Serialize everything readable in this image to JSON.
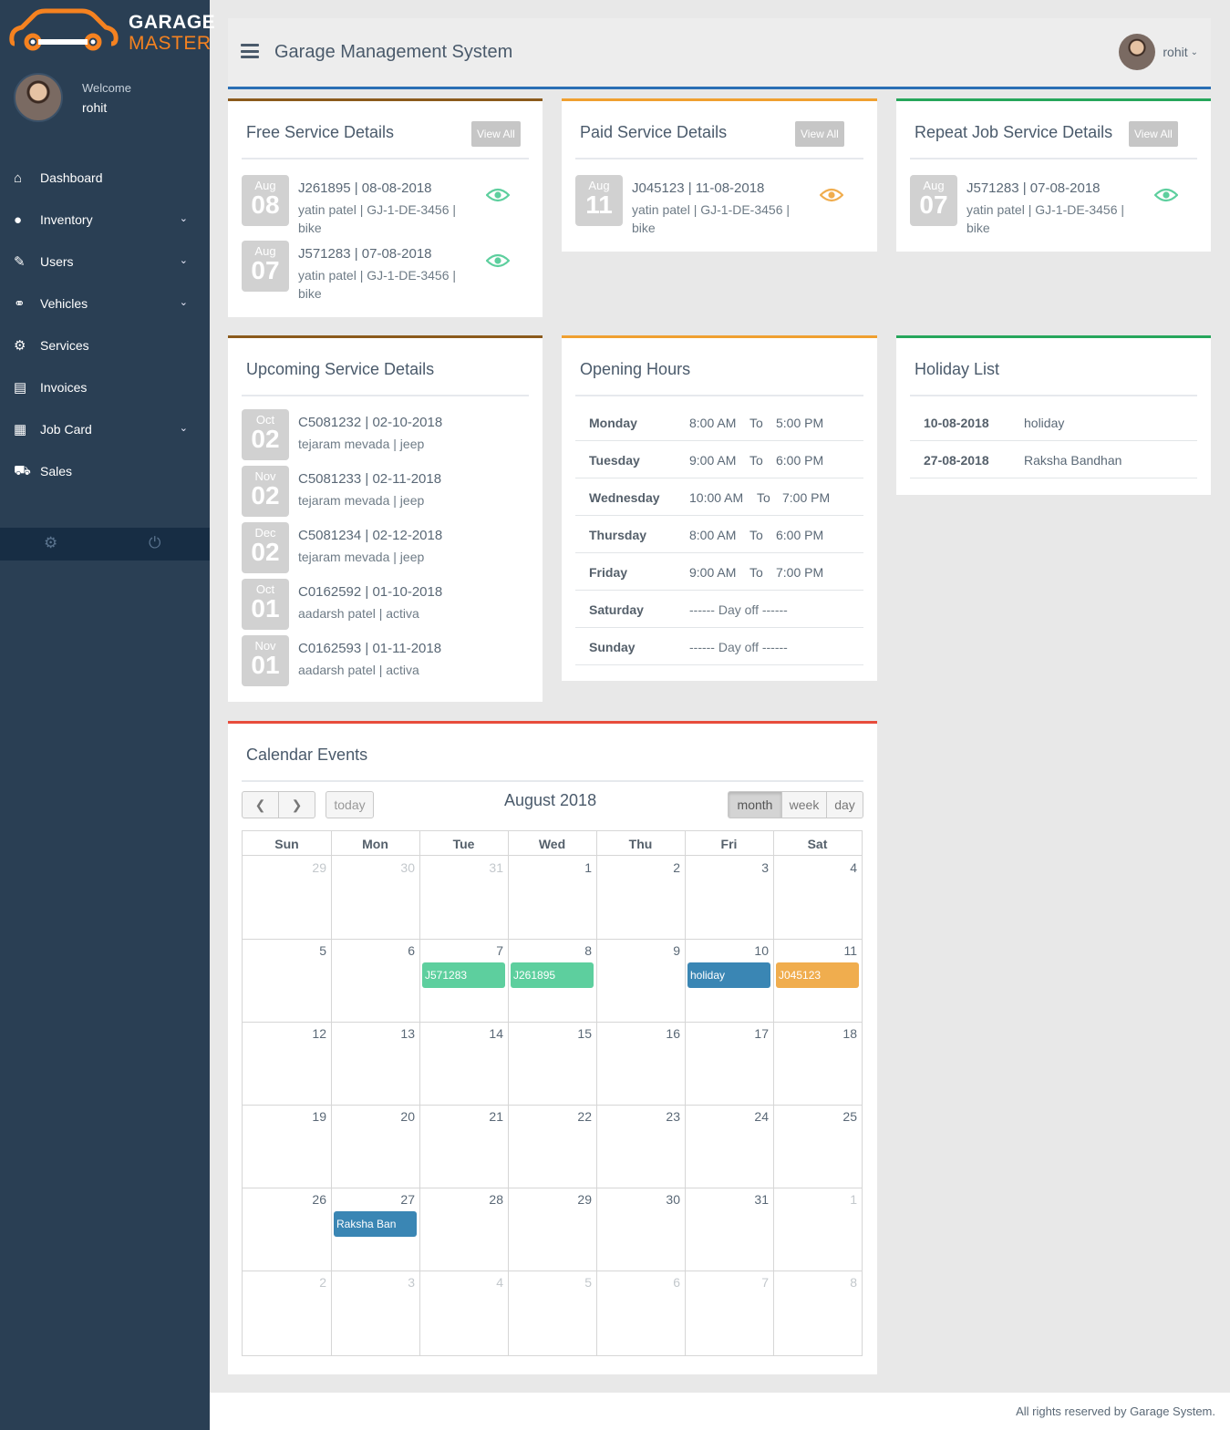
{
  "brand": {
    "line1": "GARAGE",
    "line2": "MASTER"
  },
  "profile": {
    "welcome": "Welcome",
    "name": "rohit"
  },
  "nav": [
    {
      "label": "Dashboard",
      "icon": "home-icon"
    },
    {
      "label": "Inventory",
      "icon": "user-icon"
    },
    {
      "label": "Users",
      "icon": "edit-icon"
    },
    {
      "label": "Vehicles",
      "icon": "motorcycle-icon"
    },
    {
      "label": "Services",
      "icon": "cogs-icon"
    },
    {
      "label": "Invoices",
      "icon": "file-icon"
    },
    {
      "label": "Job Card",
      "icon": "table-icon"
    },
    {
      "label": "Sales",
      "icon": "cab-icon"
    }
  ],
  "topbar": {
    "title": "Garage Management System",
    "user": "rohit"
  },
  "free": {
    "title": "Free Service Details",
    "view_all": "View All",
    "items": [
      {
        "mon": "Aug",
        "day": "08",
        "line1": "J261895 | 08-08-2018",
        "line2": "yatin patel | GJ-1-DE-3456 |",
        "line3": "bike"
      },
      {
        "mon": "Aug",
        "day": "07",
        "line1": "J571283 | 07-08-2018",
        "line2": "yatin patel | GJ-1-DE-3456 |",
        "line3": "bike"
      }
    ]
  },
  "paid": {
    "title": "Paid Service Details",
    "view_all": "View All",
    "items": [
      {
        "mon": "Aug",
        "day": "11",
        "line1": "J045123 | 11-08-2018",
        "line2": "yatin patel | GJ-1-DE-3456 |",
        "line3": "bike"
      }
    ]
  },
  "repeat": {
    "title": "Repeat Job Service Details",
    "view_all": "View All",
    "items": [
      {
        "mon": "Aug",
        "day": "07",
        "line1": "J571283 | 07-08-2018",
        "line2": "yatin patel | GJ-1-DE-3456 |",
        "line3": "bike"
      }
    ]
  },
  "upcoming": {
    "title": "Upcoming Service Details",
    "items": [
      {
        "mon": "Oct",
        "day": "02",
        "line1": "C5081232 | 02-10-2018",
        "line2": "tejaram mevada | jeep"
      },
      {
        "mon": "Nov",
        "day": "02",
        "line1": "C5081233 | 02-11-2018",
        "line2": "tejaram mevada | jeep"
      },
      {
        "mon": "Dec",
        "day": "02",
        "line1": "C5081234 | 02-12-2018",
        "line2": "tejaram mevada | jeep"
      },
      {
        "mon": "Oct",
        "day": "01",
        "line1": "C0162592 | 01-10-2018",
        "line2": "aadarsh patel | activa"
      },
      {
        "mon": "Nov",
        "day": "01",
        "line1": "C0162593 | 01-11-2018",
        "line2": "aadarsh patel | activa"
      }
    ]
  },
  "hours": {
    "title": "Opening Hours",
    "rows": [
      {
        "day": "Monday",
        "from": "8:00 AM",
        "to": "To",
        "until": "5:00 PM"
      },
      {
        "day": "Tuesday",
        "from": "9:00 AM",
        "to": "To",
        "until": "6:00 PM"
      },
      {
        "day": "Wednesday",
        "from": "10:00 AM",
        "to": "To",
        "until": "7:00 PM"
      },
      {
        "day": "Thursday",
        "from": "8:00 AM",
        "to": "To",
        "until": "6:00 PM"
      },
      {
        "day": "Friday",
        "from": "9:00 AM",
        "to": "To",
        "until": "7:00 PM"
      },
      {
        "day": "Saturday",
        "off": "------ Day off ------"
      },
      {
        "day": "Sunday",
        "off": "------ Day off ------"
      }
    ]
  },
  "holidays": {
    "title": "Holiday List",
    "rows": [
      {
        "date": "10-08-2018",
        "name": "holiday"
      },
      {
        "date": "27-08-2018",
        "name": "Raksha Bandhan"
      }
    ]
  },
  "calendar": {
    "title": "Calendar Events",
    "month_title": "August 2018",
    "today_label": "today",
    "views": [
      "month",
      "week",
      "day"
    ],
    "weekdays": [
      "Sun",
      "Mon",
      "Tue",
      "Wed",
      "Thu",
      "Fri",
      "Sat"
    ],
    "weeks": [
      [
        "29",
        "30",
        "31",
        "1",
        "2",
        "3",
        "4"
      ],
      [
        "5",
        "6",
        "7",
        "8",
        "9",
        "10",
        "11"
      ],
      [
        "12",
        "13",
        "14",
        "15",
        "16",
        "17",
        "18"
      ],
      [
        "19",
        "20",
        "21",
        "22",
        "23",
        "24",
        "25"
      ],
      [
        "26",
        "27",
        "28",
        "29",
        "30",
        "31",
        "1"
      ],
      [
        "2",
        "3",
        "4",
        "5",
        "6",
        "7",
        "8"
      ]
    ],
    "other_month": [
      [
        0,
        0
      ],
      [
        0,
        1
      ],
      [
        0,
        2
      ],
      [
        4,
        6
      ],
      [
        5,
        0
      ],
      [
        5,
        1
      ],
      [
        5,
        2
      ],
      [
        5,
        3
      ],
      [
        5,
        4
      ],
      [
        5,
        5
      ],
      [
        5,
        6
      ]
    ],
    "events": [
      {
        "label": "J571283",
        "week": 1,
        "dow": 2,
        "color": "#5dcf9e"
      },
      {
        "label": "J261895",
        "week": 1,
        "dow": 3,
        "color": "#5dcf9e"
      },
      {
        "label": "holiday",
        "week": 1,
        "dow": 5,
        "color": "#3a86b4"
      },
      {
        "label": "J045123",
        "week": 1,
        "dow": 6,
        "color": "#f0ad4e"
      },
      {
        "label": "Raksha Ban",
        "week": 4,
        "dow": 1,
        "color": "#3a86b4"
      }
    ]
  },
  "footer": "All rights reserved by Garage System.",
  "colors": {
    "sidebar": "#2a3f54",
    "accent_blue": "#2a6fb5",
    "brown": "#8b5a1c",
    "orange": "#f0a030",
    "green": "#26a65b",
    "red": "#e74c3c",
    "eye_green": "#5dcf9e",
    "eye_orange": "#f0ad4e"
  }
}
